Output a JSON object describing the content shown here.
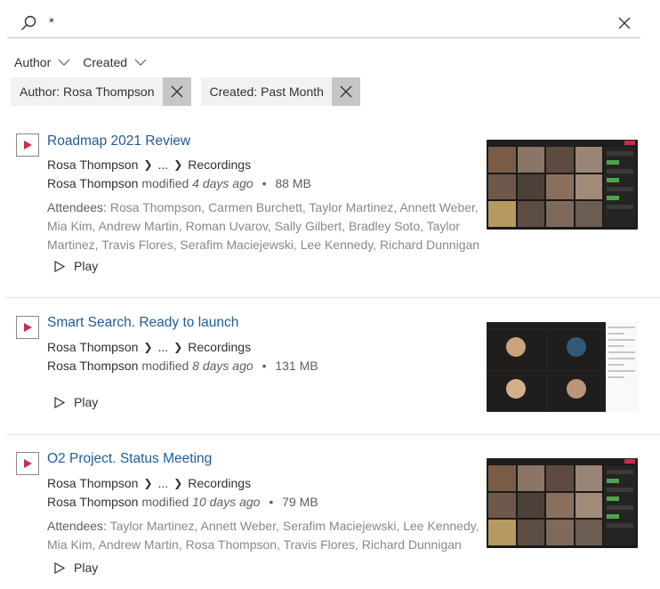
{
  "search": {
    "query": "*"
  },
  "filters": {
    "dropdowns": [
      {
        "label": "Author"
      },
      {
        "label": "Created"
      }
    ],
    "pills": [
      {
        "label": "Author: Rosa Thompson"
      },
      {
        "label": "Created: Past Month"
      }
    ]
  },
  "results": [
    {
      "title": "Roadmap 2021 Review",
      "path": {
        "owner": "Rosa Thompson",
        "ellipsis": "...",
        "folder": "Recordings"
      },
      "modified": {
        "author": "Rosa Thompson",
        "verb": "modified",
        "ago": "4 days ago",
        "size": "88 MB"
      },
      "attendees_label": "Attendees:",
      "attendees": "Rosa Thompson, Carmen Burchett, Taylor Martinez, Annett Weber, Mia Kim, Andrew Martin, Roman Uvarov, Sally Gilbert, Bradley Soto, Taylor Martinez, Travis Flores, Serafim Maciejewski, Lee Kennedy, Richard Dunnigan",
      "play_label": "Play"
    },
    {
      "title": "Smart Search. Ready to launch",
      "path": {
        "owner": "Rosa Thompson",
        "ellipsis": "...",
        "folder": "Recordings"
      },
      "modified": {
        "author": "Rosa Thompson",
        "verb": "modified",
        "ago": "8 days ago",
        "size": "131 MB"
      },
      "play_label": "Play"
    },
    {
      "title": "O2 Project. Status Meeting",
      "path": {
        "owner": "Rosa Thompson",
        "ellipsis": "...",
        "folder": "Recordings"
      },
      "modified": {
        "author": "Rosa Thompson",
        "verb": "modified",
        "ago": "10 days ago",
        "size": "79 MB"
      },
      "attendees_label": "Attendees:",
      "attendees": "Taylor Martinez, Annett Weber, Serafim Maciejewski, Lee Kennedy, Mia Kim, Andrew Martin, Rosa Thompson, Travis Flores, Richard Dunnigan",
      "play_label": "Play"
    }
  ],
  "colors": {
    "accent": "#1f5c99",
    "video_icon": "#c4314b",
    "pill_bg": "#f3f2f1",
    "pill_x_bg": "#c8c6c4"
  },
  "icons": {
    "search": "search-icon",
    "clear": "close-icon",
    "chevron": "chevron-down-icon",
    "video": "video-file-icon",
    "play": "play-icon"
  }
}
